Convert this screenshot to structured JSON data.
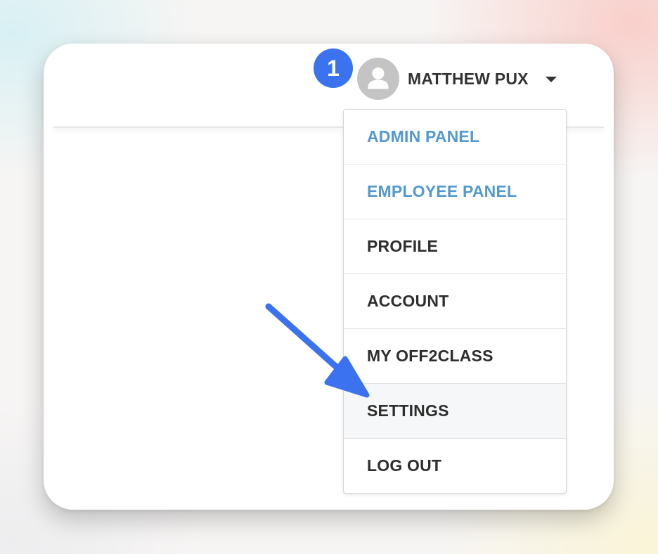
{
  "step": {
    "number": "1",
    "color": "#3a72f0"
  },
  "user": {
    "name": "MATTHEW PUX",
    "avatar_icon": "user-silhouette-icon",
    "caret_icon": "caret-down-icon"
  },
  "menu": {
    "items": [
      {
        "label": "ADMIN PANEL",
        "style": "link"
      },
      {
        "label": "EMPLOYEE PANEL",
        "style": "link"
      },
      {
        "label": "PROFILE",
        "style": "default"
      },
      {
        "label": "ACCOUNT",
        "style": "default"
      },
      {
        "label": "MY OFF2CLASS",
        "style": "default"
      },
      {
        "label": "SETTINGS",
        "style": "highlighted"
      },
      {
        "label": "LOG OUT",
        "style": "default"
      }
    ],
    "link_color": "#5399d0",
    "highlighted_item": "SETTINGS"
  },
  "annotation": {
    "icon": "pointer-arrow-icon",
    "color": "#3a72f0"
  }
}
